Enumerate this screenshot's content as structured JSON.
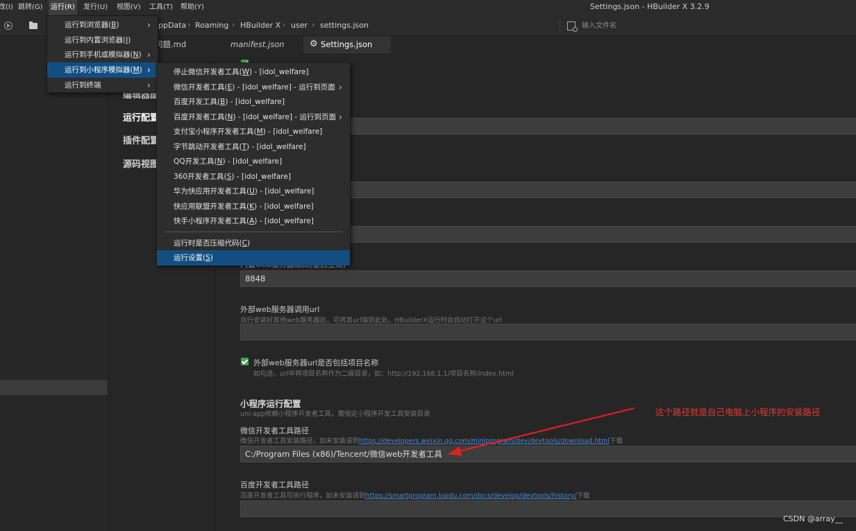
{
  "window": {
    "title": "Settings.json - HBuilder X 3.2.9"
  },
  "menubar": {
    "items": [
      "改(I)",
      "跳转(G)",
      "运行(R)",
      "发行(U)",
      "视图(V)",
      "工具(T)",
      "帮助(Y)"
    ]
  },
  "breadcrumb": [
    "ppData",
    "Roaming",
    "HBuilder X",
    "user",
    "settings.json"
  ],
  "file_search": {
    "placeholder": "输入文件名"
  },
  "tabs": [
    {
      "label": "常见问题.md",
      "italic": false,
      "active": false
    },
    {
      "label": "manifest.json",
      "italic": true,
      "active": false
    },
    {
      "label": "Settings.json",
      "italic": false,
      "active": true
    }
  ],
  "settings_nav": [
    {
      "label": "编辑器配置",
      "active": false
    },
    {
      "label": "运行配置",
      "active": true
    },
    {
      "label": "插件配置",
      "active": false
    },
    {
      "label": "源码视图",
      "active": false
    }
  ],
  "run_menu": {
    "items": [
      {
        "label": "运行到浏览器",
        "key": "B",
        "submenu": true
      },
      {
        "label": "运行到内置浏览器",
        "key": "I",
        "submenu": false
      },
      {
        "label": "运行到手机或模拟器",
        "key": "N",
        "submenu": true
      },
      {
        "label": "运行到小程序模拟器",
        "key": "M",
        "submenu": true,
        "highlighted": true
      },
      {
        "label": "运行到终端",
        "key": "",
        "submenu": true
      }
    ]
  },
  "miniprogram_menu": {
    "items": [
      {
        "label": "停止微信开发者工具",
        "key": "W",
        "suffix": " - [idol_welfare]",
        "submenu": false
      },
      {
        "label": "微信开发者工具",
        "key": "E",
        "suffix": " - [idol_welfare] - 运行到页面",
        "submenu": true
      },
      {
        "label": "百度开发工具",
        "key": "B",
        "suffix": " - [idol_welfare]",
        "submenu": false
      },
      {
        "label": "百度开发者工具",
        "key": "N",
        "suffix": " - [idol_welfare] - 运行到页面",
        "submenu": true
      },
      {
        "label": "支付宝小程序开发者工具",
        "key": "M",
        "suffix": " - [idol_welfare]",
        "submenu": false
      },
      {
        "label": "字节跳动开发者工具",
        "key": "T",
        "suffix": " - [idol_welfare]",
        "submenu": false
      },
      {
        "label": "QQ开发工具",
        "key": "N",
        "suffix": " - [idol_welfare]",
        "submenu": false
      },
      {
        "label": "360开发者工具",
        "key": "S",
        "suffix": " - [idol_welfare]",
        "submenu": false
      },
      {
        "label": "华为快应用开发者工具",
        "key": "U",
        "suffix": " - [idol_welfare]",
        "submenu": false
      },
      {
        "label": "快应用联盟开发者工具",
        "key": "K",
        "suffix": " - [idol_welfare]",
        "submenu": false
      },
      {
        "label": "快手小程序开发者工具",
        "key": "A",
        "suffix": " - [idol_welfare]",
        "submenu": false
      },
      {
        "separator": true
      },
      {
        "label": "运行时是否压缩代码",
        "key": "C",
        "suffix": "",
        "submenu": false
      },
      {
        "label": "运行设置",
        "key": "S",
        "suffix": "",
        "submenu": false,
        "highlighted": true
      }
    ]
  },
  "settings": {
    "port_label_partial": "内置web服务器端口(重启生效)",
    "port_value": "8848",
    "external_url_label": "外部web服务器调用url",
    "external_url_desc": "自行安装好其他web服务器后，可将其url填到此处。HBuilderX运行时会自动打开这个url",
    "external_url_value": "",
    "include_project_label": "外部web服务器url是否包括项目名称",
    "include_project_desc": "如勾选，url中将项目名称作为二级目录，如：http://192.168.1.1/项目名称/index.html",
    "include_project_checked": true,
    "mp_section_title": "小程序运行配置",
    "mp_section_desc": "uni-app依赖小程序开发者工具，需指定小程序开发工具安装目录",
    "wechat_label": "微信开发者工具路径",
    "wechat_desc_pre": "微信开发者工具安装路径，如未安装请到",
    "wechat_desc_link": "https://developers.weixin.qq.com/miniprogram/dev/devtools/download.html",
    "wechat_desc_post": "下载",
    "wechat_value": "C:/Program Files (x86)/Tencent/微信web开发者工具",
    "baidu_label": "百度开发者工具路径",
    "baidu_desc_pre": "百度开发者工具可执行程序，如未安装请到",
    "baidu_desc_link": "https://smartprogram.baidu.com/docs/develop/devtools/history/",
    "baidu_desc_post": "下载",
    "baidu_value": ""
  },
  "annotation": {
    "text": "这个路径就是自己电脑上小程序的安装路径",
    "color": "#e8392c"
  },
  "watermark": "CSDN @array__",
  "colors": {
    "accent": "#124e82",
    "checkbox": "#3ea84a",
    "link": "#4b8cd8"
  }
}
